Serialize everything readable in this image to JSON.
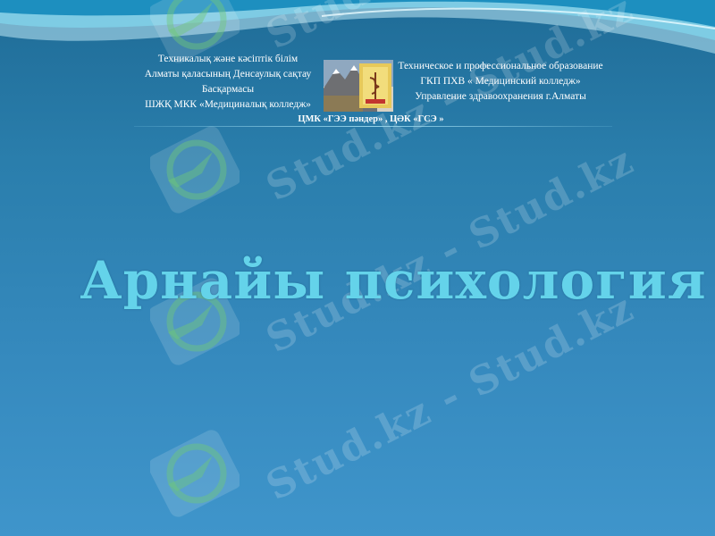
{
  "header": {
    "left_lines": [
      "Техникалық және кәсіптік білім",
      "Алматы қаласының Денсаулық сақтау",
      "Басқармасы",
      "ШЖҚ МКК «Медициналық колледж»"
    ],
    "right_lines": [
      "Техническое и профессиональное образование",
      "ГКП ПХВ « Медицинский колледж»",
      "Управление здравоохранения г.Алматы"
    ],
    "dept_line": "ЦМК «ГЭЭ пәндер» , ЦӘК «ГСЭ »"
  },
  "title": "Арнайы психология",
  "watermark": {
    "text": "Stud.kz - Stud.kz",
    "icon": "hummingbird-logo-icon"
  },
  "colors": {
    "background_top": "#1f6c97",
    "background_bottom": "#3f95cb",
    "title": "#64d3ea",
    "header_text": "#ffffff"
  }
}
